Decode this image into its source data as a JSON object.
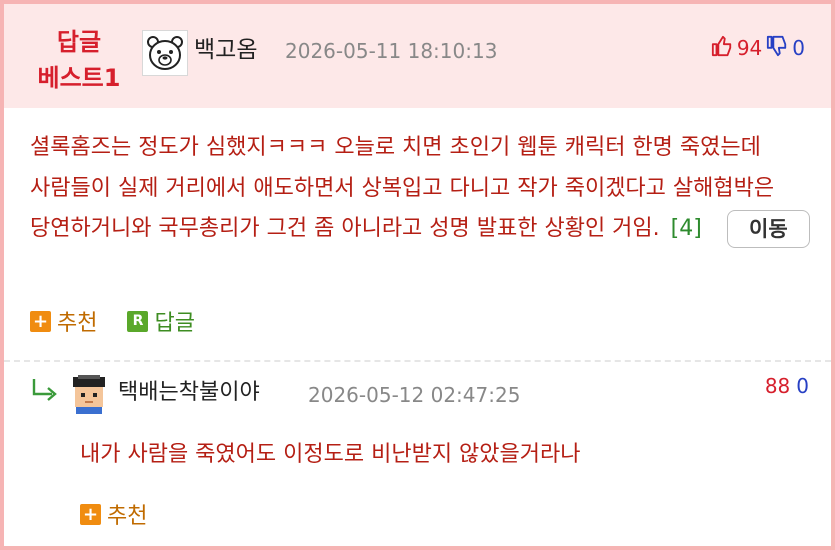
{
  "best_comment": {
    "badge": "답글\n베스트1",
    "badge_line1": "답글",
    "badge_line2": "베스트1",
    "avatar_icon": "polar-bear-icon",
    "username": "백고옴",
    "timestamp": "2026-05-11 18:10:13",
    "upvotes": "94",
    "downvotes": "0",
    "body": "셜록홈즈는 정도가 심했지ㅋㅋㅋ 오늘로 치면 초인기 웹툰 캐릭터 한명 죽였는데 사람들이 실제 거리에서 애도하면서 상복입고 다니고 작가 죽이겠다고 살해협박은 당연하거니와 국무총리가 그건 좀 아니라고 성명 발표한 상황인 거임.",
    "reply_count": "[4]",
    "move_button": "이동",
    "recommend_label": "추천",
    "reply_label": "답글"
  },
  "reply": {
    "avatar_icon": "pixel-character-icon",
    "username": "택배는착불이야",
    "timestamp": "2026-05-12 02:47:25",
    "upvotes": "88",
    "downvotes": "0",
    "body": "내가 사람을 죽였어도 이정도로 비난받지 않았을거라나",
    "recommend_label": "추천"
  },
  "colors": {
    "accent_red": "#d61f2c",
    "body_text": "#b51f14",
    "header_bg": "#fde8e8",
    "down_blue": "#2740c4",
    "reply_green": "#2e8b2e"
  }
}
